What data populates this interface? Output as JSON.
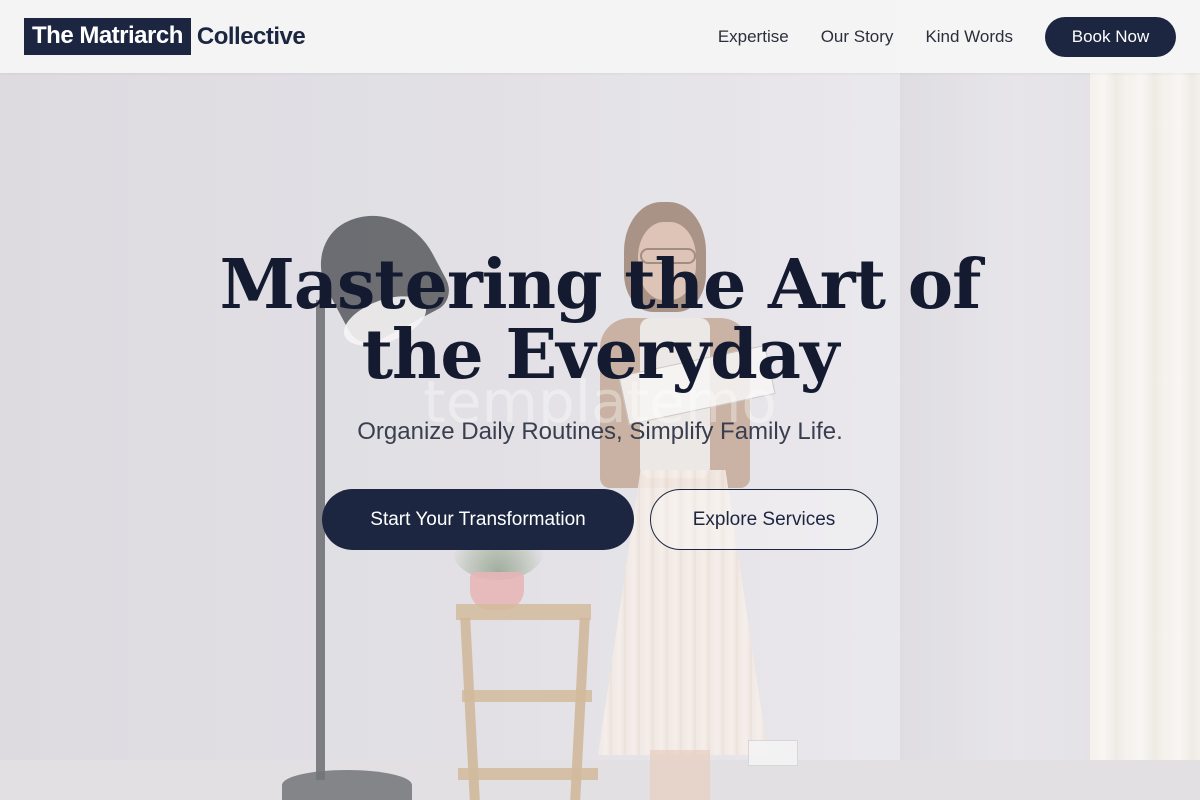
{
  "header": {
    "logo_boxed": "The Matriarch",
    "logo_rest": "Collective",
    "nav": [
      {
        "label": "Expertise"
      },
      {
        "label": "Our Story"
      },
      {
        "label": "Kind Words"
      }
    ],
    "cta_label": "Book Now"
  },
  "hero": {
    "headline": "Mastering the Art of the Everyday",
    "subheadline": "Organize Daily Routines, Simplify Family Life.",
    "watermark": "templatemo",
    "primary_button": "Start Your Transformation",
    "secondary_button": "Explore Services"
  },
  "colors": {
    "brand_navy": "#1c2640",
    "header_bg": "#f5f5f5"
  }
}
